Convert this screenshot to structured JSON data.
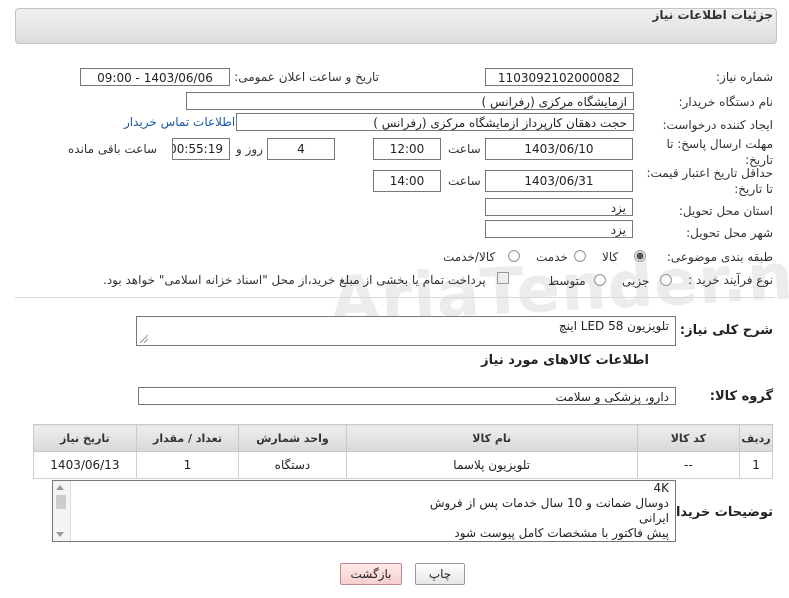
{
  "header": {
    "title": "جزئیات اطلاعات نیاز"
  },
  "fields": {
    "need_number": {
      "label": "شماره نیاز:",
      "value": "1103092102000082"
    },
    "announce_datetime": {
      "label": "تاریخ و ساعت اعلان عمومی:",
      "value": "1403/06/06 - 09:00"
    },
    "buyer_org": {
      "label": "نام دستگاه خریدار:",
      "value": "ازمایشگاه مرکزی (رفرانس )"
    },
    "requester": {
      "label": "ایجاد کننده درخواست:",
      "value": "حجت دهقان کارپرداز ازمایشگاه مرکزی (رفرانس )",
      "contact_link": "اطلاعات تماس خریدار"
    },
    "reply_deadline": {
      "label": "مهلت ارسال پاسخ: تا تاریخ:",
      "date": "1403/06/10",
      "time_label": "ساعت",
      "time": "12:00",
      "days": "4",
      "days_label": "روز و",
      "remaining": "00:55:19",
      "remaining_label": "ساعت باقی مانده"
    },
    "price_validity": {
      "label": "حداقل تاریخ اعتبار قیمت: تا تاریخ:",
      "date": "1403/06/31",
      "time_label": "ساعت",
      "time": "14:00"
    },
    "province": {
      "label": "استان محل تحویل:",
      "value": "یزد"
    },
    "city": {
      "label": "شهر محل تحویل:",
      "value": "یزد"
    },
    "category": {
      "label": "طبقه بندی موضوعی:",
      "options": [
        "کالا",
        "خدمت",
        "کالا/خدمت"
      ],
      "selected": "کالا"
    },
    "purchase_type": {
      "label": "نوع فرآیند خرید :",
      "options": [
        "جزیی",
        "متوسط"
      ],
      "selected": "جزیی",
      "note": "پرداخت تمام یا بخشی از مبلغ خرید،از محل \"اسناد خزانه اسلامی\" خواهد بود."
    }
  },
  "description": {
    "label": "شرح کلی نیاز:",
    "value": "تلویزیون LED 58 اینچ"
  },
  "goods_section_title": "اطلاعات کالاهای مورد نیاز",
  "goods_group": {
    "label": "گروه کالا:",
    "value": "دارو، پزشکی و سلامت"
  },
  "table": {
    "headers": [
      "ردیف",
      "کد کالا",
      "نام کالا",
      "واحد شمارش",
      "تعداد / مقدار",
      "تاریخ نیاز"
    ],
    "rows": [
      [
        "1",
        "--",
        "تلویزیون پلاسما",
        "دستگاه",
        "1",
        "1403/06/13"
      ]
    ]
  },
  "buyer_notes": {
    "label": "توضیحات خریدار:",
    "text": "4K\nدوسال ضمانت و 10 سال خدمات پس از فروش\nایرانی\nپیش فاکتور با مشخصات کامل پیوست شود"
  },
  "buttons": {
    "print": "چاپ",
    "back": "بازگشت"
  },
  "watermark": "AriaTender.neT"
}
